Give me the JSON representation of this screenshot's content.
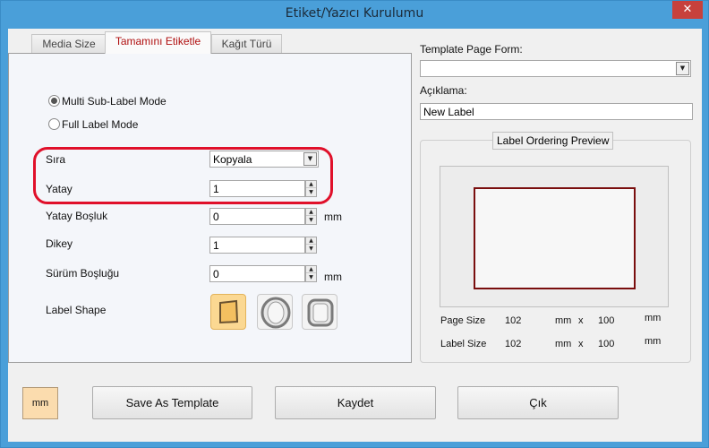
{
  "window": {
    "title": "Etiket/Yazıcı Kurulumu",
    "close_glyph": "✕"
  },
  "tabs": [
    {
      "label": "Media Size",
      "active": false
    },
    {
      "label": "Tamamını Etiketle",
      "active": true
    },
    {
      "label": "Kağıt Türü",
      "active": false
    }
  ],
  "mode": {
    "multi_label": "Multi Sub-Label Mode",
    "full_label": "Full Label Mode",
    "selected": "multi"
  },
  "fields": {
    "sira": {
      "label": "Sıra",
      "value": "Kopyala"
    },
    "yatay": {
      "label": "Yatay",
      "value": "1"
    },
    "yatay_bosluk": {
      "label": "Yatay Boşluk",
      "value": "0",
      "unit": "mm"
    },
    "dikey": {
      "label": "Dikey",
      "value": "1"
    },
    "surum_boslugu": {
      "label": "Sürüm Boşluğu",
      "value": "0",
      "unit": "mm"
    },
    "label_shape": {
      "label": "Label Shape",
      "selected": "rectangle"
    }
  },
  "template": {
    "page_form_label": "Template Page Form:",
    "page_form_value": "",
    "aciklama_label": "Açıklama:",
    "aciklama_value": "New Label"
  },
  "preview": {
    "title": "Label Ordering Preview",
    "page_size_label": "Page Size",
    "page_width": "102",
    "page_height": "100",
    "label_size_label": "Label Size",
    "label_width": "102",
    "label_height": "100",
    "unit": "mm",
    "times": "x"
  },
  "buttons": {
    "unit_toggle": "mm",
    "save_as_template": "Save As Template",
    "kaydet": "Kaydet",
    "cik": "Çık"
  },
  "colors": {
    "title_bar": "#4a9fd9",
    "close_button": "#c7413c",
    "active_tab_text": "#b01010",
    "highlight_outline": "#e0102a",
    "label_outline": "#7a0e0e",
    "selected_shape": "#fbd892"
  }
}
